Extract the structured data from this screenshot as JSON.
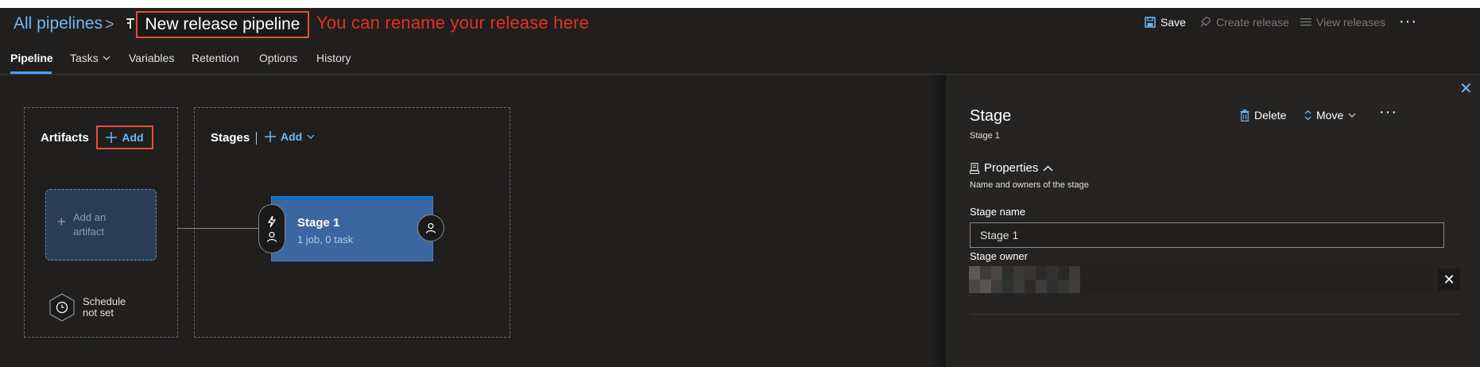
{
  "header": {
    "breadcrumb_root": "All pipelines",
    "breadcrumb_sep": ">",
    "pipeline_name": "New release pipeline",
    "annotation": "You can rename your release here",
    "actions": {
      "save": "Save",
      "create_release": "Create release",
      "view_releases": "View releases",
      "more": "···"
    }
  },
  "tabs": [
    {
      "label": "Pipeline",
      "active": true
    },
    {
      "label": "Tasks",
      "active": false
    },
    {
      "label": "Variables",
      "active": false
    },
    {
      "label": "Retention",
      "active": false
    },
    {
      "label": "Options",
      "active": false
    },
    {
      "label": "History",
      "active": false
    }
  ],
  "canvas": {
    "artifacts_label": "Artifacts",
    "artifacts_add": "Add",
    "add_artifact_line1": "Add an",
    "add_artifact_line2": "artifact",
    "schedule_line1": "Schedule",
    "schedule_line2": "not set",
    "stages_label": "Stages",
    "stages_add": "Add",
    "stage": {
      "name": "Stage 1",
      "summary": "1 job, 0 task"
    }
  },
  "panel": {
    "title": "Stage",
    "subtitle": "Stage 1",
    "delete": "Delete",
    "move": "Move",
    "more": "···",
    "properties_title": "Properties",
    "properties_desc": "Name and owners of the stage",
    "stage_name_label": "Stage name",
    "stage_name_value": "Stage 1",
    "stage_owner_label": "Stage owner",
    "remove_owner": "✕"
  },
  "colors": {
    "accent": "#6cb8f6",
    "annotation_red": "#e74c3c",
    "stage_blue": "#3a679f",
    "background": "#201f1e",
    "panel": "#252423"
  },
  "icons": [
    "chevron-right-icon",
    "pipeline-icon",
    "save-icon",
    "rocket-icon",
    "list-icon",
    "chevron-down-icon",
    "plus-icon",
    "lightning-person-icon",
    "person-icon",
    "clock-icon",
    "close-icon",
    "trash-icon",
    "up-down-icon",
    "properties-icon",
    "chevron-up-icon"
  ]
}
